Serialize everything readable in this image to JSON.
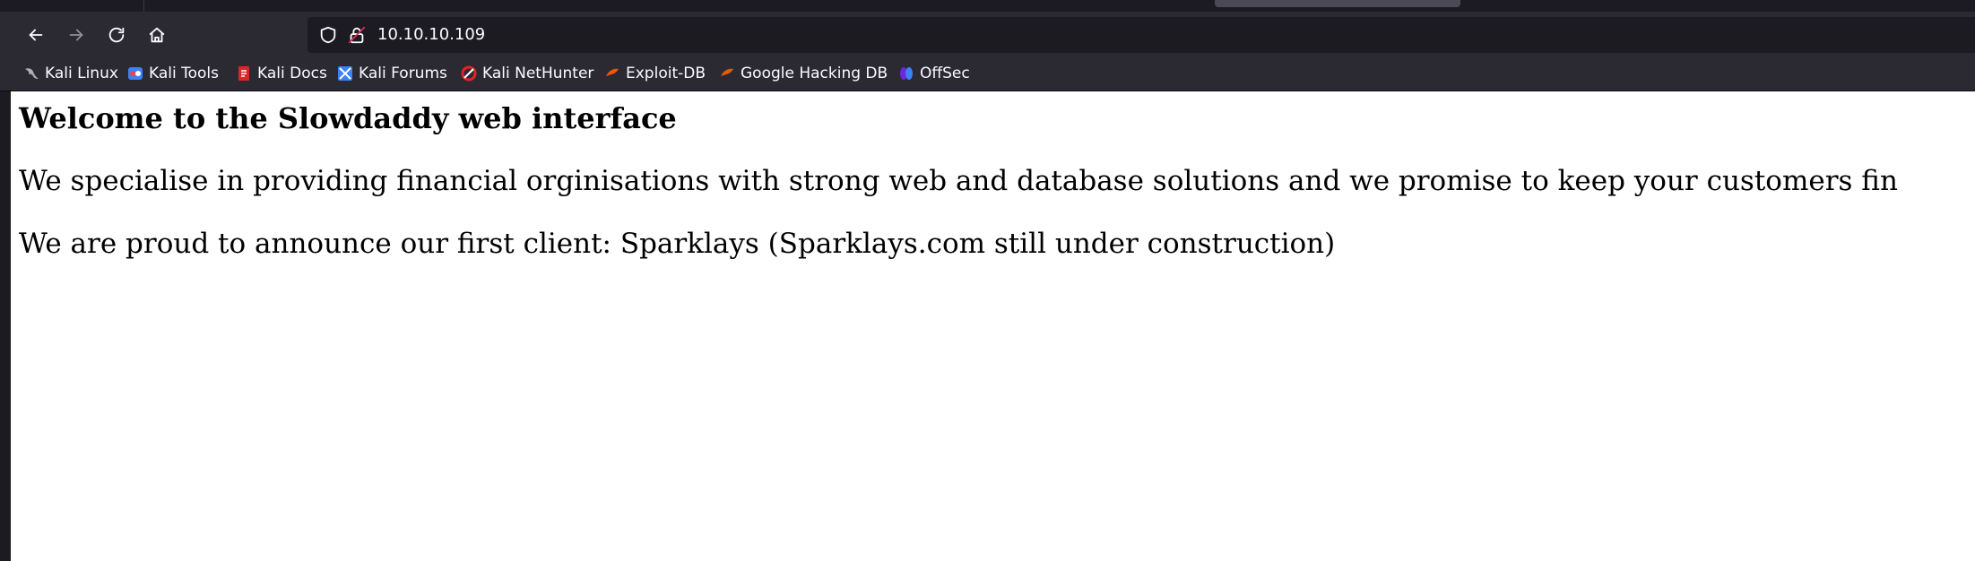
{
  "browser": {
    "url": "10.10.10.109",
    "bookmarks": [
      {
        "label": "Kali Linux",
        "icon": "kali-dragon-icon",
        "color": "#b0b0b0"
      },
      {
        "label": "Kali Tools",
        "icon": "kali-tools-icon",
        "color": "#3b82f6"
      },
      {
        "label": "Kali Docs",
        "icon": "kali-docs-icon",
        "color": "#dc2626"
      },
      {
        "label": "Kali Forums",
        "icon": "kali-forums-icon",
        "color": "#3b82f6"
      },
      {
        "label": "Kali NetHunter",
        "icon": "nethunter-icon",
        "color": "#dc2626"
      },
      {
        "label": "Exploit-DB",
        "icon": "exploit-db-icon",
        "color": "#ea580c"
      },
      {
        "label": "Google Hacking DB",
        "icon": "ghdb-icon",
        "color": "#ea580c"
      },
      {
        "label": "OffSec",
        "icon": "offsec-icon",
        "color": "#6d28d9"
      }
    ]
  },
  "page": {
    "heading": "Welcome to the Slowdaddy web interface",
    "paragraph1": "We specialise in providing financial orginisations with strong web and database solutions and we promise to keep your customers fin",
    "paragraph2": "We are proud to announce our first client: Sparklays (Sparklays.com still under construction)"
  }
}
